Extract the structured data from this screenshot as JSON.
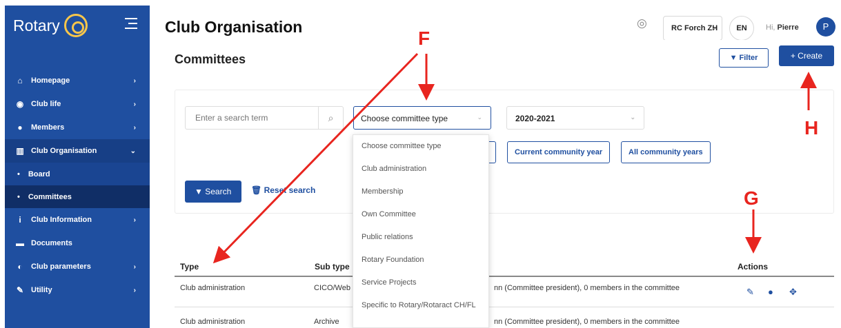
{
  "brand": {
    "name": "Rotary"
  },
  "sidebar": {
    "items": [
      {
        "label": "Homepage",
        "icon": "home-icon"
      },
      {
        "label": "Club life",
        "icon": "globe-icon"
      },
      {
        "label": "Members",
        "icon": "user-icon"
      },
      {
        "label": "Club Organisation",
        "icon": "institution-icon"
      },
      {
        "label": "Board",
        "icon": "bullet"
      },
      {
        "label": "Committees",
        "icon": "bullet"
      },
      {
        "label": "Club Information",
        "icon": "info-icon"
      },
      {
        "label": "Documents",
        "icon": "folder-icon"
      },
      {
        "label": "Club parameters",
        "icon": "toggle-icon"
      },
      {
        "label": "Utility",
        "icon": "wrench-icon"
      }
    ]
  },
  "header": {
    "title": "Club Organisation",
    "club": "RC Forch ZH",
    "language": "EN",
    "greeting_hi": "Hi,",
    "user_name": "Pierre",
    "avatar_initial": "P"
  },
  "page": {
    "section_title": "Committees",
    "filter_label": "Filter",
    "create_label": "+ Create"
  },
  "filters": {
    "search_placeholder": "Enter a search term",
    "committee_type": "Choose committee type",
    "year": "2020-2021",
    "current_year_btn": "Current community year",
    "all_years_btn": "All community years",
    "search_btn": "Search",
    "reset_btn": "Reset search"
  },
  "dropdown": {
    "options": [
      "Choose committee type",
      "Club administration",
      "Membership",
      "Own Committee",
      "Public relations",
      "Rotary Foundation",
      "Service Projects",
      "Specific to Rotary/Rotaract CH/FL"
    ]
  },
  "table": {
    "columns": [
      "Type",
      "Sub type",
      "Actions"
    ],
    "rows": [
      {
        "type": "Club administration",
        "subtype": "CICO/Web",
        "members": "nn (Committee president), 0 members in the committee"
      },
      {
        "type": "Club administration",
        "subtype": "Archive",
        "members": "nn (Committee president), 0 members in the committee"
      }
    ]
  },
  "annotations": {
    "f": "F",
    "g": "G",
    "h": "H",
    "color": "#e8251f"
  },
  "colors": {
    "brand_blue": "#1f4fa0",
    "accent_gold": "#f7c64b"
  }
}
